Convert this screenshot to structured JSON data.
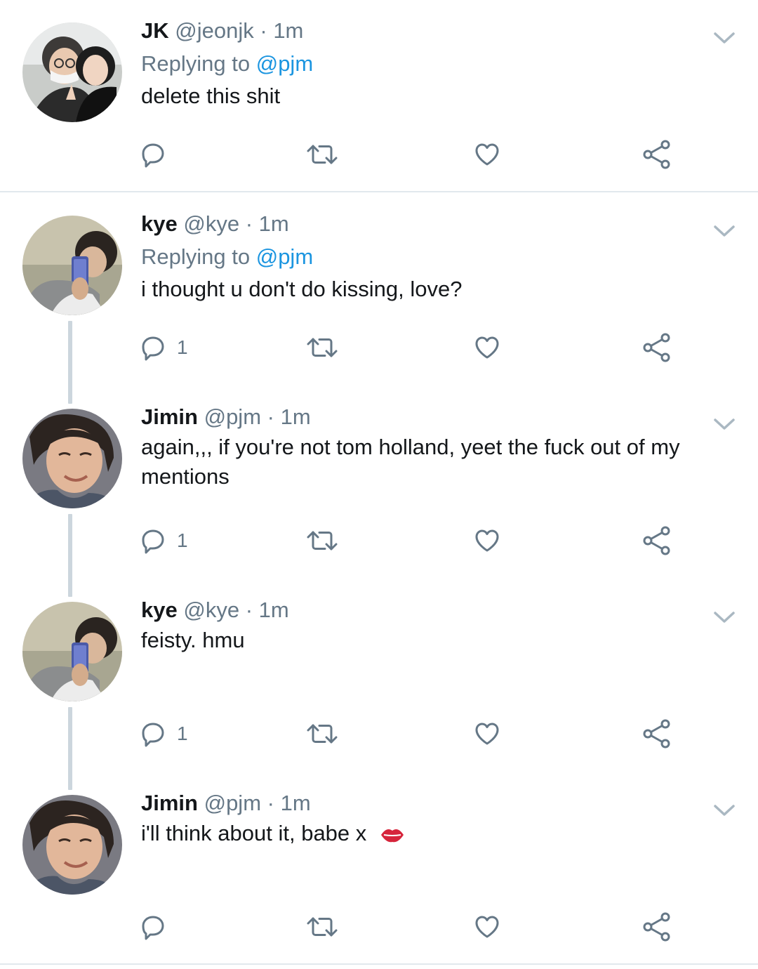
{
  "tweets": [
    {
      "name": "JK",
      "handle": "@jeonjk",
      "sep": "·",
      "time": "1m",
      "reply_prefix": "Replying to",
      "reply_mention": "@pjm",
      "text": "delete this shit",
      "reply_count": "",
      "avatar": "jk-avatar"
    },
    {
      "name": "kye",
      "handle": "@kye",
      "sep": "·",
      "time": "1m",
      "reply_prefix": "Replying to",
      "reply_mention": "@pjm",
      "text": "i thought u don't do kissing, love?",
      "reply_count": "1",
      "avatar": "kye-avatar"
    },
    {
      "name": "Jimin",
      "handle": "@pjm",
      "sep": "·",
      "time": "1m",
      "text": "again,,, if you're not tom holland, yeet the fuck out of my mentions",
      "reply_count": "1",
      "avatar": "jimin-avatar"
    },
    {
      "name": "kye",
      "handle": "@kye",
      "sep": "·",
      "time": "1m",
      "text": "feisty. hmu",
      "reply_count": "1",
      "avatar": "kye-avatar"
    },
    {
      "name": "Jimin",
      "handle": "@pjm",
      "sep": "·",
      "time": "1m",
      "text": "i'll think about it, babe x",
      "emoji": "kiss-mark-icon",
      "reply_count": "",
      "avatar": "jimin-avatar"
    }
  ],
  "icons": [
    "reply-icon",
    "retweet-icon",
    "like-icon",
    "share-icon",
    "chevron-down-icon"
  ],
  "colors": {
    "link": "#1b95e0",
    "secondary": "#657786",
    "thread_line": "#ccd6dd",
    "divider": "#e1e8ed"
  }
}
